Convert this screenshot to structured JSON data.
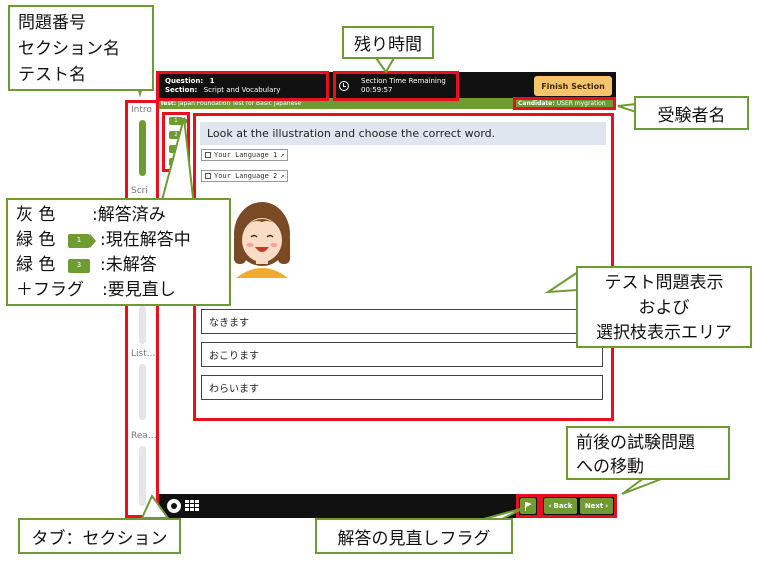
{
  "header": {
    "question_label": "Question:",
    "question_value": "1",
    "section_label": "Section:",
    "section_value": "Script and Vocabulary",
    "timer_label": "Section Time Remaining",
    "timer_value": "00:59:57",
    "finish_button": "Finish Section",
    "test_label": "Test:",
    "test_value": "Japan Foundation Test for Basic Japanese",
    "candidate_label": "Candidate:",
    "candidate_value": "USER mygration"
  },
  "sidebar": {
    "tabs": [
      "Intro",
      "Scri",
      "List...",
      "Rea..."
    ]
  },
  "questions": {
    "buttons": [
      "1",
      "2",
      "3",
      "4"
    ]
  },
  "content": {
    "prompt": "Look at the illustration  and choose the correct word.",
    "language_links": [
      "Your Language 1",
      "Your Language 2"
    ],
    "choices": [
      "なきます",
      "おこります",
      "わらいます"
    ]
  },
  "footer": {
    "back_label": "Back",
    "next_label": "Next"
  },
  "annotations": {
    "question_section_test": [
      "問題番号",
      "セクション名",
      "テスト名"
    ],
    "time_remaining": "残り時間",
    "candidate_name": "受験者名",
    "legend": [
      {
        "label": "灰 色",
        "value": ":解答済み"
      },
      {
        "label": "緑 色",
        "value": ":現在解答中",
        "badge": "1"
      },
      {
        "label": "緑 色",
        "value": ":未解答",
        "badge": "3"
      },
      {
        "label": "＋フラグ",
        "value": ":要見直し"
      }
    ],
    "display_area": [
      "テスト問題表示",
      "および",
      "選択枝表示エリア"
    ],
    "navigation": [
      "前後の試験問題",
      "への移動"
    ],
    "tab_section": "タブ：セクション",
    "review_flag": "解答の見直しフラグ"
  },
  "colors": {
    "accent_green": "#6f9b33",
    "highlight_red": "#e8101e",
    "finish_orange": "#f6c46b",
    "prompt_bg": "#dfe6ef"
  },
  "icons": {
    "timer": "clock-icon",
    "settings": "gear-icon",
    "grid": "grid-icon",
    "flag": "flag-icon",
    "external": "external-link-icon"
  }
}
